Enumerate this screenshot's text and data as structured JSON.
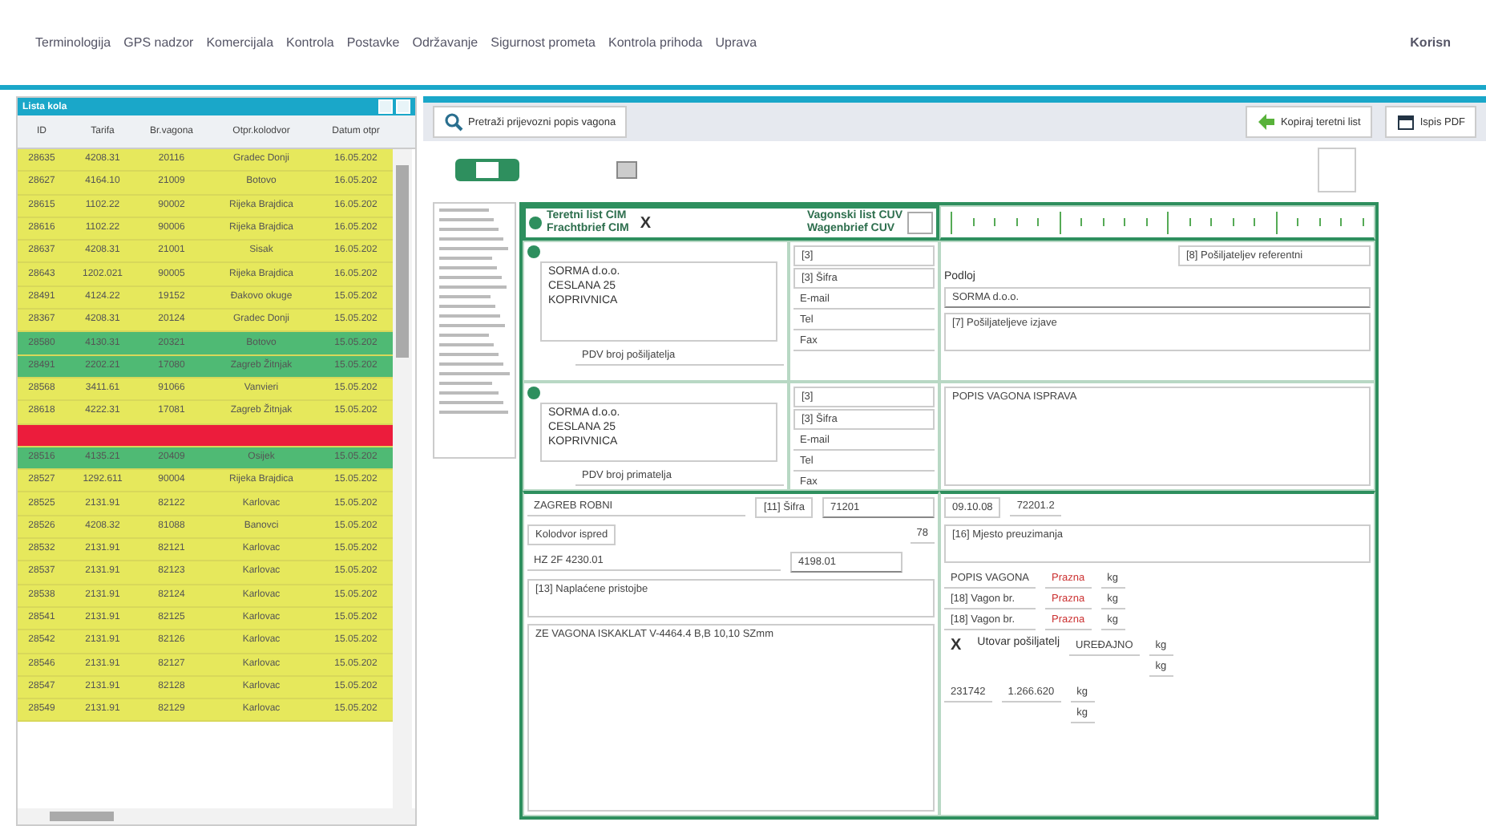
{
  "menu": {
    "items": [
      "Terminologija",
      "GPS nadzor",
      "Komercijala",
      "Kontrola",
      "Postavke",
      "Održavanje",
      "Sigurnost prometa",
      "Kontrola prihoda",
      "Uprava"
    ],
    "user": "Korisn"
  },
  "list_panel": {
    "title": "Lista kola",
    "columns": [
      "ID",
      "Tarifa",
      "Br.vagona",
      "Otpr.kolodvor",
      "Datum otpr"
    ],
    "rows": [
      {
        "cells": [
          "28635",
          "4208.31",
          "20116",
          "Gradec Donji",
          "16.05.202"
        ],
        "color": "#e6e85c"
      },
      {
        "cells": [
          "28627",
          "4164.10",
          "21009",
          "Botovo",
          "16.05.202"
        ],
        "color": "#e6e85c"
      },
      {
        "cells": [
          "28615",
          "1102.22",
          "90002",
          "Rijeka Brajdica",
          "16.05.202"
        ],
        "color": "#e6e85c"
      },
      {
        "cells": [
          "28616",
          "1102.22",
          "90006",
          "Rijeka Brajdica",
          "16.05.202"
        ],
        "color": "#e6e85c"
      },
      {
        "cells": [
          "28637",
          "4208.31",
          "21001",
          "Sisak",
          "16.05.202"
        ],
        "color": "#e6e85c"
      },
      {
        "cells": [
          "28643",
          "1202.021",
          "90005",
          "Rijeka Brajdica",
          "16.05.202"
        ],
        "color": "#e6e85c"
      },
      {
        "cells": [
          "28491",
          "4124.22",
          "19152",
          "Đakovo okuge",
          "15.05.202"
        ],
        "color": "#e6e85c"
      },
      {
        "cells": [
          "28367",
          "4208.31",
          "20124",
          "Gradec Donji",
          "15.05.202"
        ],
        "color": "#e6e85c"
      },
      {
        "cells": [
          "28580",
          "4130.31",
          "20321",
          "Botovo",
          "15.05.202"
        ],
        "color": "#4fba74"
      },
      {
        "cells": [
          "28491",
          "2202.21",
          "17080",
          "Zagreb Žitnjak",
          "15.05.202"
        ],
        "color": "#4fba74"
      },
      {
        "cells": [
          "28568",
          "3411.61",
          "91066",
          "Vanvieri",
          "15.05.202"
        ],
        "color": "#e6e85c"
      },
      {
        "cells": [
          "28618",
          "4222.31",
          "17081",
          "Zagreb Žitnjak",
          "15.05.202"
        ],
        "color": "#e6e85c"
      },
      {
        "color": "#ec1c3c"
      },
      {
        "cells": [
          "28516",
          "4135.21",
          "20409",
          "Osijek",
          "15.05.202"
        ],
        "color": "#4fba74"
      },
      {
        "cells": [
          "28527",
          "1292.611",
          "90004",
          "Rijeka Brajdica",
          "15.05.202"
        ],
        "color": "#e6e85c"
      },
      {
        "cells": [
          "28525",
          "2131.91",
          "82122",
          "Karlovac",
          "15.05.202"
        ],
        "color": "#e6e85c"
      },
      {
        "cells": [
          "28526",
          "4208.32",
          "81088",
          "Banovci",
          "15.05.202"
        ],
        "color": "#e6e85c"
      },
      {
        "cells": [
          "28532",
          "2131.91",
          "82121",
          "Karlovac",
          "15.05.202"
        ],
        "color": "#e6e85c"
      },
      {
        "cells": [
          "28537",
          "2131.91",
          "82123",
          "Karlovac",
          "15.05.202"
        ],
        "color": "#e6e85c"
      },
      {
        "cells": [
          "28538",
          "2131.91",
          "82124",
          "Karlovac",
          "15.05.202"
        ],
        "color": "#e6e85c"
      },
      {
        "cells": [
          "28541",
          "2131.91",
          "82125",
          "Karlovac",
          "15.05.202"
        ],
        "color": "#e6e85c"
      },
      {
        "cells": [
          "28542",
          "2131.91",
          "82126",
          "Karlovac",
          "15.05.202"
        ],
        "color": "#e6e85c"
      },
      {
        "cells": [
          "28546",
          "2131.91",
          "82127",
          "Karlovac",
          "15.05.202"
        ],
        "color": "#e6e85c"
      },
      {
        "cells": [
          "28547",
          "2131.91",
          "82128",
          "Karlovac",
          "15.05.202"
        ],
        "color": "#e6e85c"
      },
      {
        "cells": [
          "28549",
          "2131.91",
          "82129",
          "Karlovac",
          "15.05.202"
        ],
        "color": "#e6e85c"
      }
    ]
  },
  "toolbar": {
    "search_button": "Pretraži prijevozni popis vagona",
    "buttons": [
      "Kopiraj teretni list",
      "Ispis PDF"
    ]
  },
  "form": {
    "cim": {
      "lines": [
        "Teretni list CIM",
        "Frachtbrief CIM"
      ],
      "mark": "X"
    },
    "cuv": {
      "lines": [
        "Vagonski list CUV",
        "Wagenbrief CUV"
      ],
      "checked": false
    },
    "sender": {
      "lines": [
        "SORMA d.o.o.",
        "CESLANA 25",
        "KOPRIVNICA"
      ],
      "vat": "PDV broj pošiljatelja",
      "code": "[3]",
      "code2": "[3] Šifra",
      "contacts": [
        "E-mail",
        "Tel",
        "Fax"
      ]
    },
    "consignee": {
      "lines": [
        "SORMA d.o.o.",
        "CESLANA 25",
        "KOPRIVNICA"
      ],
      "vat": "PDV broj primatelja",
      "code": "[3]",
      "code2": "[3] Šifra",
      "contacts": [
        "E-mail",
        "Tel",
        "Fax"
      ]
    },
    "payer": {
      "label": "Podloj",
      "reference": "[8] Pošiljateljev referentni",
      "value": "SORMA d.o.o.",
      "declaration": "[7] Pošiljateljeve izjave"
    },
    "documents": "POPIS VAGONA ISPRAVA",
    "departure": {
      "station": "ZAGREB ROBNI",
      "code": "[11] Šifra",
      "code_value": "71201",
      "date": "09.10.08",
      "number": "72201.2",
      "place": "[16] Mjesto preuzimanja"
    },
    "station_select": {
      "value": "Kolodvor ispred",
      "extra": "78"
    },
    "route": {
      "value": "HZ 2F 4230.01",
      "select": "4198.01"
    },
    "wagons": {
      "lines": [
        "POPIS VAGONA",
        "[18] Vagon br.",
        "[18] Vagon br."
      ],
      "states": [
        "Prazna",
        "Prazna",
        "Prazna"
      ],
      "units": [
        "kg",
        "kg",
        "kg"
      ]
    },
    "charges": "[13] Naplaćene pristojbe",
    "loading": {
      "mark": "X",
      "label": "Utovar pošiljatelj",
      "value": "UREĐAJNO",
      "units": [
        "kg",
        "kg"
      ]
    },
    "description": "ZE VAGONA ISKAKLAT V-4464.4 B,B 10,10 SZmm",
    "mass": "231742",
    "total": "1.266.620",
    "totals_units": [
      "kg",
      "kg"
    ]
  }
}
